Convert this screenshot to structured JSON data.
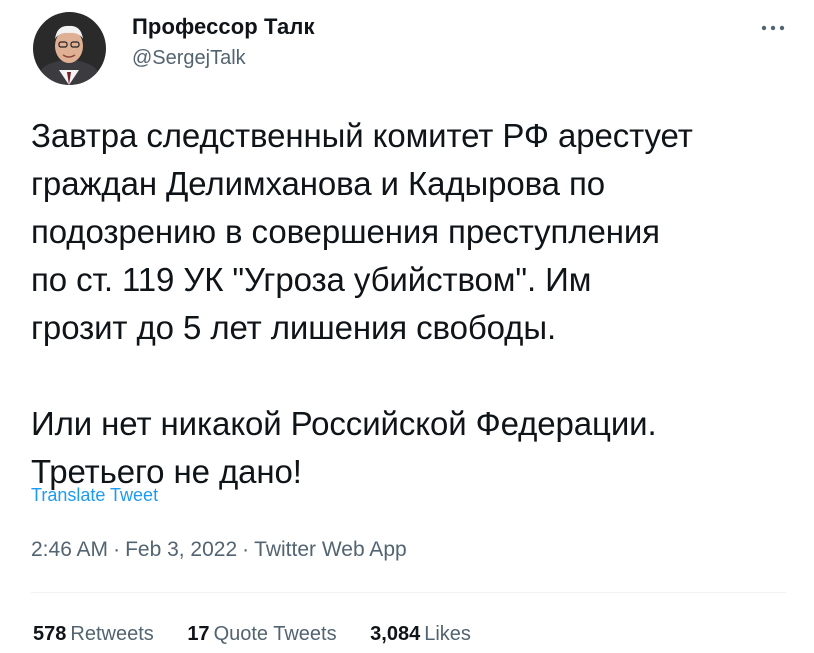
{
  "author": {
    "display_name": "Профессор Талк",
    "handle": "@SergejTalk"
  },
  "icons": {
    "avatar": "avatar-portrait",
    "more": "more-horizontal-icon"
  },
  "tweet": {
    "text": "Завтра следственный комитет РФ арестует\nграждан Делимханова и Кадырова по\nподозрению в совершения преступления\nпо ст. 119 УК \"Угроза убийством\". Им\nгрозит до 5 лет лишения свободы.\n\nИли нет никакой Российской Федерации.\nТретьего не дано!",
    "translate_label": "Translate Tweet"
  },
  "meta": {
    "time": "2:46 AM",
    "separator": "·",
    "date": "Feb 3, 2022",
    "source": "Twitter Web App"
  },
  "stats": {
    "retweets": {
      "count": "578",
      "label": "Retweets"
    },
    "quote_tweets": {
      "count": "17",
      "label": "Quote Tweets"
    },
    "likes": {
      "count": "3,084",
      "label": "Likes"
    }
  },
  "colors": {
    "link": "#1d9bf0",
    "secondary_text": "#536471",
    "primary_text": "#0f1419",
    "divider": "#eff3f4"
  }
}
